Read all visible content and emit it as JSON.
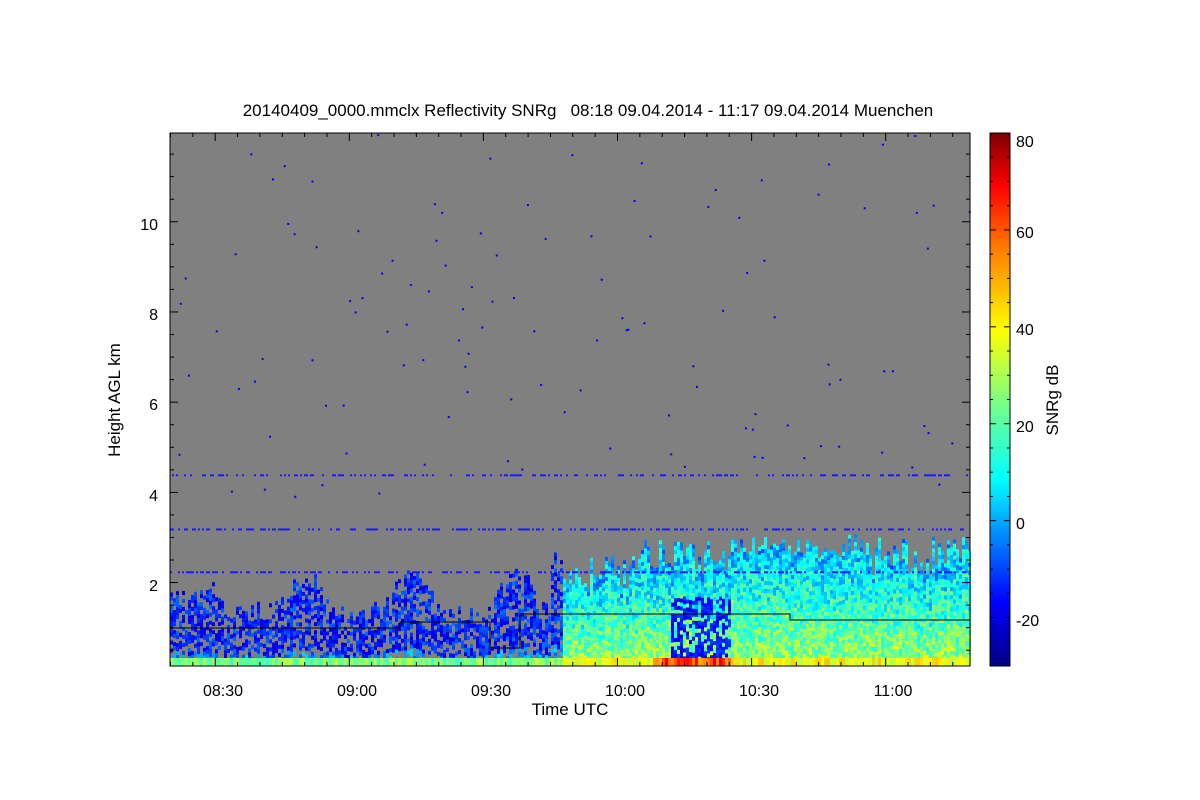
{
  "chart_data": {
    "type": "heatmap",
    "title": "20140409_0000.mmclx Reflectivity SNRg   08:18 09.04.2014 - 11:17 09.04.2014 Muenchen",
    "xlabel": "Time UTC",
    "ylabel": "Height AGL km",
    "x_ticks": [
      "08:30",
      "09:00",
      "09:30",
      "10:00",
      "10:30",
      "11:00"
    ],
    "y_ticks": [
      "2",
      "4",
      "6",
      "8",
      "10"
    ],
    "xlim_minutes": [
      498,
      677
    ],
    "ylim_km": [
      0.15,
      11.9
    ],
    "colorbar": {
      "label": "SNRg dB",
      "ticks": [
        "-20",
        "0",
        "20",
        "40",
        "60",
        "80"
      ],
      "range": [
        -30,
        80
      ],
      "colors": [
        "#00007f",
        "#0000ff",
        "#007fff",
        "#00ffff",
        "#7fff7f",
        "#ffff00",
        "#ff7f00",
        "#ff0000",
        "#7f0000"
      ]
    },
    "background_color": "#808080",
    "grid": false
  }
}
